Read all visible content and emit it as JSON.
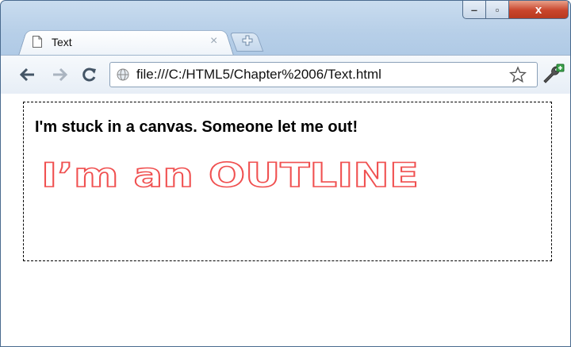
{
  "tab": {
    "title": "Text",
    "close_glyph": "×"
  },
  "window_controls": {
    "minimize": "‒",
    "maximize": "▫",
    "close": "x"
  },
  "toolbar": {
    "url": "file:///C:/HTML5/Chapter%2006/Text.html"
  },
  "canvas": {
    "line1": "I'm stuck in a canvas. Someone let me out!",
    "outline_text": "I’m an OUTLINE",
    "outline_color": "#f05050"
  },
  "icons": [
    "page-icon",
    "new-tab-icon",
    "back-arrow-icon",
    "forward-arrow-icon",
    "reload-icon",
    "globe-icon",
    "star-icon",
    "wrench-icon",
    "minimize-icon",
    "maximize-icon",
    "close-icon"
  ]
}
